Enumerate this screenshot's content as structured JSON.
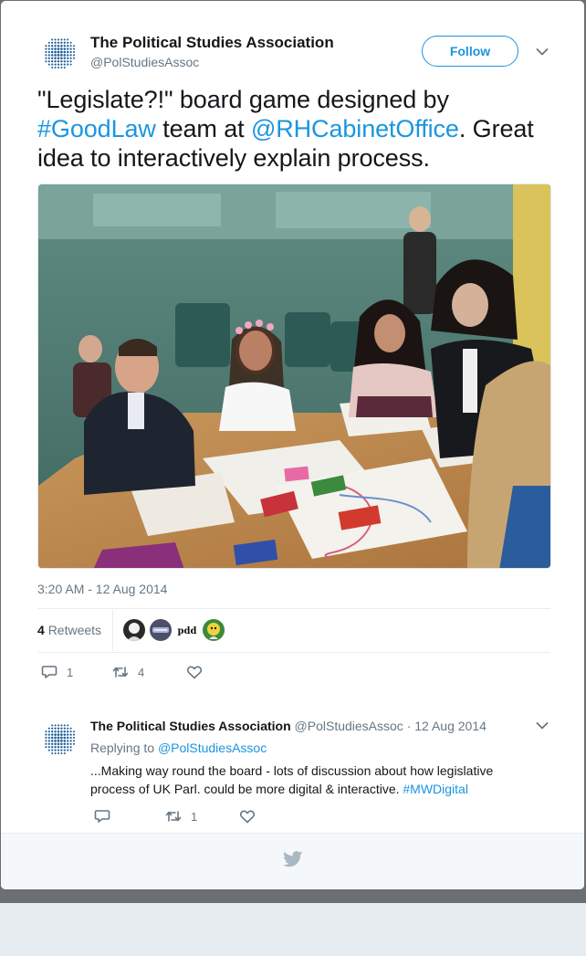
{
  "tweet": {
    "author_name": "The Political Studies Association",
    "author_handle": "@PolStudiesAssoc",
    "follow_label": "Follow",
    "text_segments": [
      {
        "text": "\"Legislate?!\" board game designed by ",
        "link": false
      },
      {
        "text": "#GoodLaw",
        "link": true
      },
      {
        "text": " team at ",
        "link": false
      },
      {
        "text": "@RHCabinetOffice",
        "link": true
      },
      {
        "text": ". Great idea to interactively explain process.",
        "link": false
      }
    ],
    "timestamp": "3:20 AM - 12 Aug 2014",
    "retweets_count": "4",
    "retweets_label": "Retweets",
    "retweeter_avatars": [
      "photo-avatar",
      "logo-avatar",
      "pdd-avatar",
      "cartoon-avatar"
    ],
    "pdd_label": "pdd",
    "replies": "1",
    "retweets": "4",
    "likes": ""
  },
  "reply": {
    "author_name": "The Political Studies Association",
    "author_handle": "@PolStudiesAssoc",
    "date": "12 Aug 2014",
    "replying_prefix": "Replying to",
    "replying_to": "@PolStudiesAssoc",
    "text": "...Making way round the board - lots of discussion about how legislative process of UK Parl. could be more digital & interactive.",
    "hashtag": "#MWDigital",
    "replies": "",
    "retweets": "1",
    "likes": ""
  },
  "icons": {
    "caret": "chevron-down-icon",
    "reply": "reply-icon",
    "retweet": "retweet-icon",
    "like": "heart-icon",
    "brand": "twitter-bird-icon"
  },
  "colors": {
    "link": "#1b95e0",
    "text": "#14171a",
    "muted": "#657786",
    "border": "#e6ecf0",
    "avatar_dots": "#1f5f9a"
  }
}
